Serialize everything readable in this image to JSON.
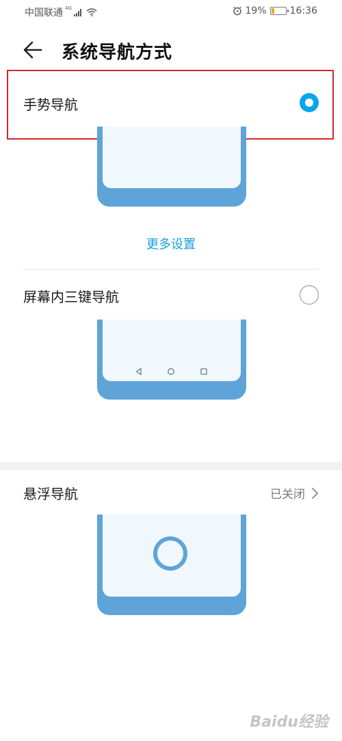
{
  "status_bar": {
    "carrier": "中国联通",
    "network_type": "4G",
    "battery_percent": "19%",
    "battery_level": 0.19,
    "time": "16:36",
    "icons": [
      "signal-icon",
      "wifi-icon",
      "alarm-icon",
      "battery-icon"
    ]
  },
  "header": {
    "title": "系统导航方式",
    "back_icon": "arrow-left-icon"
  },
  "options": {
    "gesture": {
      "label": "手势导航",
      "selected": true
    },
    "more_settings": "更多设置",
    "three_key": {
      "label": "屏幕内三键导航",
      "selected": false,
      "nav_icons": [
        "back-triangle-icon",
        "home-circle-icon",
        "recent-square-icon"
      ]
    },
    "floating": {
      "label": "悬浮导航",
      "value": "已关闭"
    }
  },
  "watermark": "Baidu经验",
  "colors": {
    "accent": "#0aa6e8",
    "link": "#1a9de0",
    "phone_shell": "#5fa4d8",
    "phone_screen": "#f1f8fd",
    "highlight": "#d9242a"
  }
}
